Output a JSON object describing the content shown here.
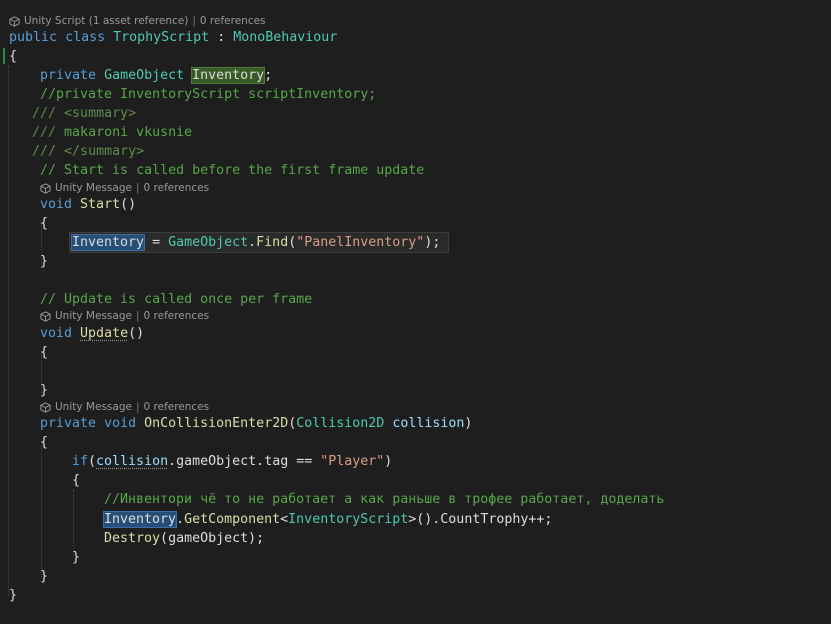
{
  "codelens": {
    "class_lens": {
      "label": "Unity Script (1 asset reference)",
      "refs": "0 references"
    },
    "start_lens": {
      "label": "Unity Message",
      "refs": "0 references"
    },
    "update_lens": {
      "label": "Unity Message",
      "refs": "0 references"
    },
    "collision_lens": {
      "label": "Unity Message",
      "refs": "0 references"
    }
  },
  "tokens": {
    "public": "public",
    "class": "class",
    "private": "private",
    "void": "void",
    "if": "if",
    "class_name": "TrophyScript",
    "colon": " : ",
    "base_class": "MonoBehaviour",
    "brace_open": "{",
    "brace_close": "}",
    "gameobject_type": "GameObject",
    "inventory_field": "Inventory",
    "semicolon": ";",
    "commented_field": "//private InventoryScript scriptInventory;",
    "xml_prefix": "///",
    "xml_summary_open": "<summary>",
    "xml_text": "makaroni vkusnie",
    "xml_summary_close": "</summary>",
    "start_comment": "// Start is called before the first frame update",
    "start_method": "Start",
    "parens": "()",
    "assign": " = ",
    "dot": ".",
    "find_method": "Find",
    "paren_open": "(",
    "paren_close": ")",
    "find_arg": "\"PanelInventory\"",
    "close_stmt": ");",
    "update_comment": "// Update is called once per frame",
    "update_method": "Update",
    "collision_method": "OnCollisionEnter2D",
    "collision_type": "Collision2D",
    "collision_param": "collision",
    "gameobject_member": "gameObject",
    "tag_member": "tag",
    "eq": " == ",
    "player_str": "\"Player\"",
    "ru_comment": "//Инвентори чё то не работает а как раньше в трофее работает, доделать",
    "getcomponent_method": "GetComponent",
    "lt": "<",
    "inventory_script_type": "InventoryScript",
    "gt": ">",
    "count_trophy": "().CountTrophy++;",
    "destroy_method": "Destroy",
    "destroy_arg": "gameObject"
  }
}
